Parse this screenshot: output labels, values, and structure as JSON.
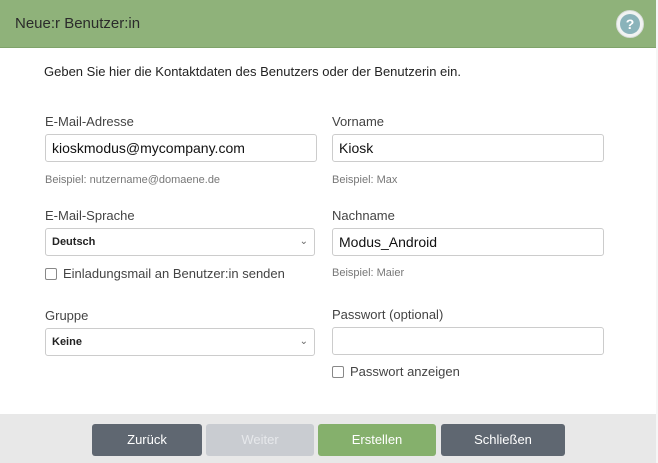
{
  "dialog": {
    "title": "Neue:r Benutzer:in",
    "help_label": "?",
    "intro": "Geben Sie hier die Kontaktdaten des Benutzers oder der Benutzerin ein."
  },
  "form": {
    "email": {
      "label": "E-Mail-Adresse",
      "value": "kioskmodus@mycompany.com",
      "hint": "Beispiel: nutzername@domaene.de"
    },
    "firstname": {
      "label": "Vorname",
      "value": "Kiosk",
      "hint": "Beispiel: Max"
    },
    "email_language": {
      "label": "E-Mail-Sprache",
      "value": "Deutsch"
    },
    "lastname": {
      "label": "Nachname",
      "value": "Modus_Android",
      "hint": "Beispiel: Maier"
    },
    "invite_checkbox": {
      "label": "Einladungsmail an Benutzer:in senden",
      "checked": false
    },
    "group": {
      "label": "Gruppe",
      "value": "Keine"
    },
    "password": {
      "label": "Passwort (optional)",
      "value": ""
    },
    "show_password_checkbox": {
      "label": "Passwort anzeigen",
      "checked": false
    }
  },
  "footer": {
    "back": "Zurück",
    "next": "Weiter",
    "create": "Erstellen",
    "close": "Schließen"
  },
  "colors": {
    "header": "#8fb27a",
    "primary_button": "#85b06c",
    "secondary_button": "#5f6771",
    "disabled_button": "#c9ccd1"
  }
}
